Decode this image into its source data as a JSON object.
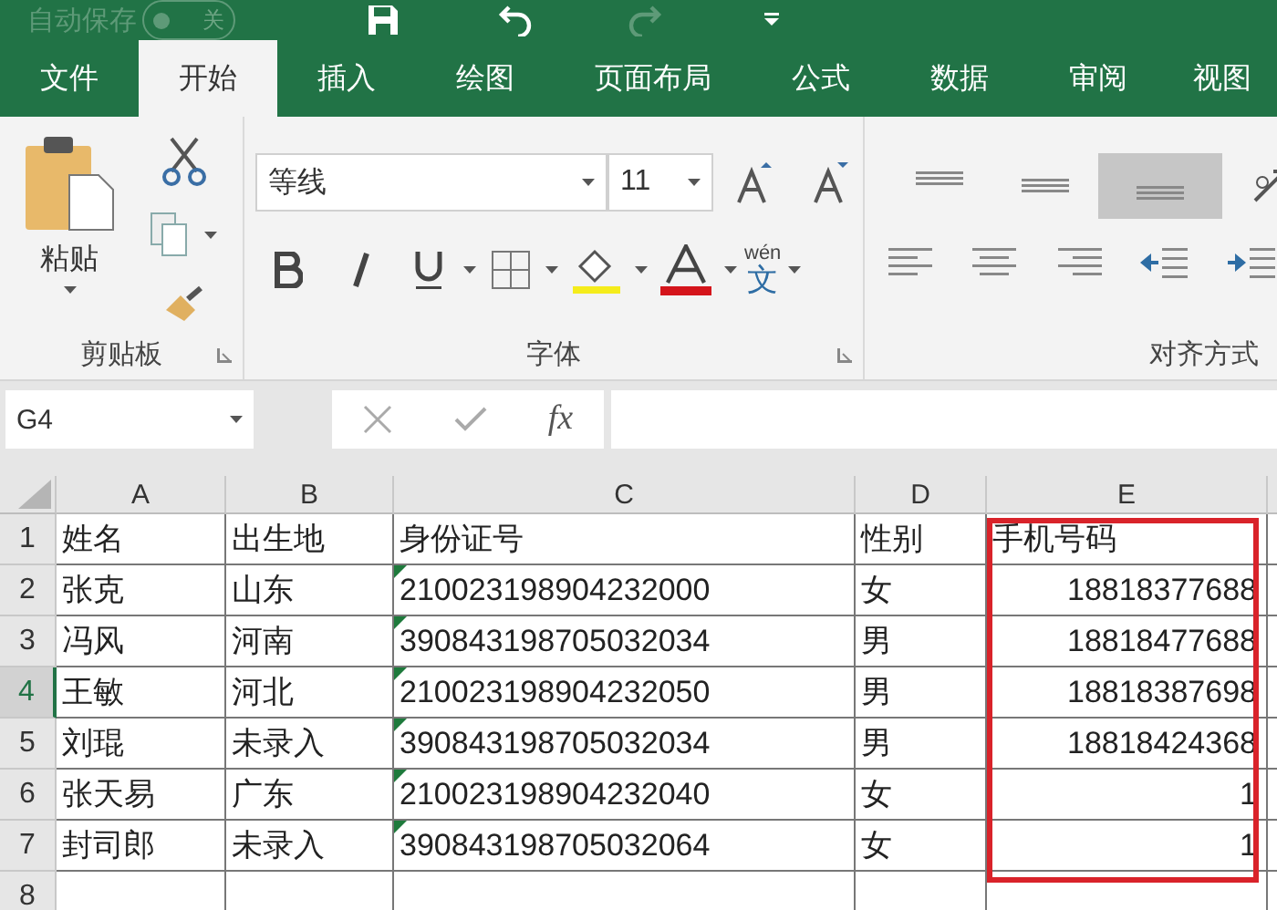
{
  "title_bar": {
    "autosave_label": "自动保存",
    "autosave_on": false,
    "autosave_state": "关",
    "redo_disabled": true
  },
  "tabs": [
    {
      "label": "文件",
      "selected": false
    },
    {
      "label": "开始",
      "selected": true
    },
    {
      "label": "插入",
      "selected": false
    },
    {
      "label": "绘图",
      "selected": false
    },
    {
      "label": "页面布局",
      "selected": false
    },
    {
      "label": "公式",
      "selected": false
    },
    {
      "label": "数据",
      "selected": false
    },
    {
      "label": "审阅",
      "selected": false
    },
    {
      "label": "视图",
      "selected": false
    }
  ],
  "ribbon": {
    "clipboard": {
      "paste_label": "粘贴",
      "group_label": "剪贴板"
    },
    "font": {
      "font_name": "等线",
      "font_size": "11",
      "phonetic_top": "wén",
      "phonetic_bottom": "文",
      "group_label": "字体"
    },
    "alignment": {
      "vertical": [
        {
          "kind": "top",
          "selected": false
        },
        {
          "kind": "middle",
          "selected": false
        },
        {
          "kind": "bottom",
          "selected": true
        }
      ],
      "group_label": "对齐方式"
    }
  },
  "formula_bar": {
    "name_box": "G4",
    "fx": "fx"
  },
  "sheet": {
    "columns": [
      {
        "label": "A",
        "highlighted": false
      },
      {
        "label": "B",
        "highlighted": false
      },
      {
        "label": "C",
        "highlighted": false
      },
      {
        "label": "D",
        "highlighted": false
      },
      {
        "label": "E",
        "highlighted": true
      }
    ],
    "rows": [
      {
        "number": "1",
        "selected": false,
        "cells": [
          "姓名",
          "出生地",
          "身份证号",
          "性别",
          "手机号码"
        ],
        "flagged": false
      },
      {
        "number": "2",
        "selected": false,
        "cells": [
          "张克",
          "山东",
          "210023198904232000",
          "女",
          "18818377688"
        ],
        "flagged": true
      },
      {
        "number": "3",
        "selected": false,
        "cells": [
          "冯风",
          "河南",
          "390843198705032034",
          "男",
          "18818477688"
        ],
        "flagged": true
      },
      {
        "number": "4",
        "selected": true,
        "cells": [
          "王敏",
          "河北",
          "210023198904232050",
          "男",
          "18818387698"
        ],
        "flagged": true
      },
      {
        "number": "5",
        "selected": false,
        "cells": [
          "刘琨",
          "未录入",
          "390843198705032034",
          "男",
          "18818424368"
        ],
        "flagged": true
      },
      {
        "number": "6",
        "selected": false,
        "cells": [
          "张天易",
          "广东",
          "210023198904232040",
          "女",
          "1"
        ],
        "flagged": true
      },
      {
        "number": "7",
        "selected": false,
        "cells": [
          "封司郎",
          "未录入",
          "390843198705032064",
          "女",
          "1"
        ],
        "flagged": true
      },
      {
        "number": "8",
        "selected": false,
        "cells": [
          "",
          "",
          "",
          "",
          ""
        ],
        "flagged": false
      }
    ]
  }
}
